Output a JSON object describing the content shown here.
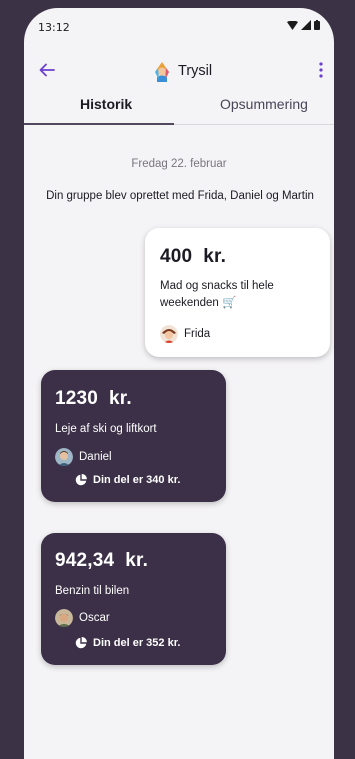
{
  "statusbar": {
    "time": "13:12"
  },
  "appbar": {
    "title": "Trysil"
  },
  "tabs": [
    {
      "label": "Historik",
      "active": true
    },
    {
      "label": "Opsummering",
      "active": false
    }
  ],
  "timeline": {
    "date": "Fredag 22. februar",
    "group_created": "Din gruppe blev oprettet med Frida, Daniel og Martin"
  },
  "expenses": [
    {
      "amount": "400  kr.",
      "description": "Mad og snacks til hele weekenden 🛒",
      "paid_by": "Frida",
      "share": ""
    },
    {
      "amount": "1230  kr.",
      "description": "Leje af ski og liftkort",
      "paid_by": "Daniel",
      "share": "Din del er 340 kr."
    },
    {
      "amount": "942,34  kr.",
      "description": "Benzin til bilen",
      "paid_by": "Oscar",
      "share": "Din del er 352 kr."
    }
  ],
  "colors": {
    "background": "#3b3245",
    "card_dark": "#3b3047",
    "accent": "#7c5bd6"
  }
}
